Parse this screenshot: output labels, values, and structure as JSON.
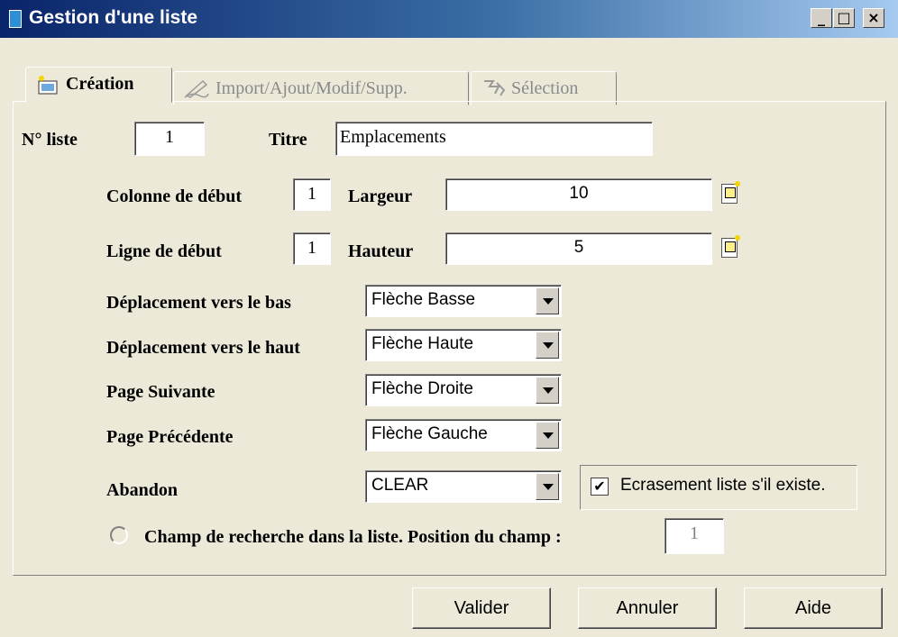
{
  "window": {
    "title": "Gestion d'une liste",
    "controls": {
      "minimize": "_",
      "maximize": "□",
      "close": "×"
    }
  },
  "tabs": [
    {
      "label": "Création",
      "active": true,
      "icon": "creation-icon"
    },
    {
      "label": "Import/Ajout/Modif/Supp.",
      "active": false,
      "icon": "pen-icon"
    },
    {
      "label": "Sélection",
      "active": false,
      "icon": "selection-icon"
    }
  ],
  "form": {
    "list_no_label": "N° liste",
    "list_no_value": "1",
    "title_label": "Titre",
    "title_value": "Emplacements",
    "start_col_label": "Colonne de début",
    "start_col_value": "1",
    "width_label": "Largeur",
    "width_value": "10",
    "start_row_label": "Ligne de début",
    "start_row_value": "1",
    "height_label": "Hauteur",
    "height_value": "5",
    "move_down_label": "Déplacement vers le bas",
    "move_down_value": "Flèche Basse",
    "move_up_label": "Déplacement vers le haut",
    "move_up_value": "Flèche Haute",
    "next_page_label": "Page Suivante",
    "next_page_value": "Flèche Droite",
    "prev_page_label": "Page Précédente",
    "prev_page_value": "Flèche Gauche",
    "abandon_label": "Abandon",
    "abandon_value": "CLEAR",
    "overwrite_label": "Ecrasement liste s'il existe.",
    "overwrite_checked": true,
    "search_label": "Champ de recherche dans la liste. Position du champ :",
    "search_position_value": "1"
  },
  "buttons": {
    "validate": "Valider",
    "cancel": "Annuler",
    "help": "Aide"
  }
}
